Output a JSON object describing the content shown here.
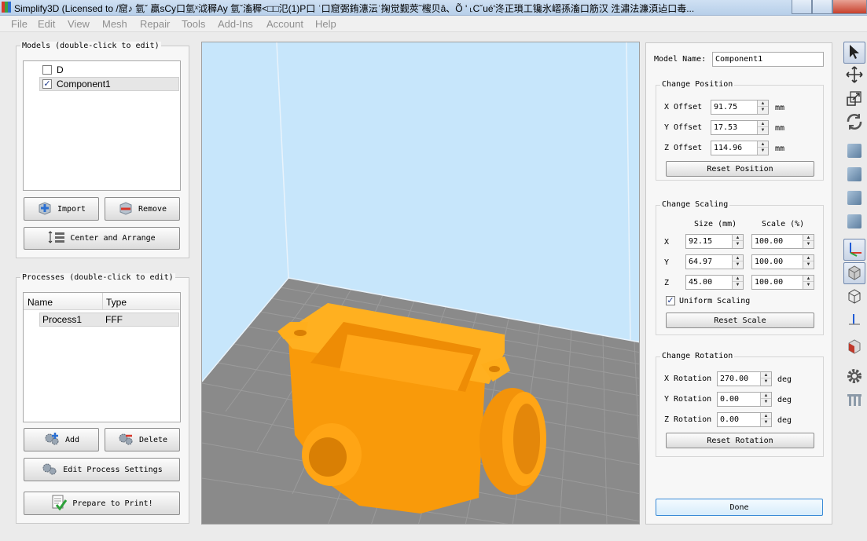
{
  "window": {
    "title": "Simplify3D (Licensed to /窟♪  氫ˇ  贏sCy口氫ˣ泧稺Ay  氫ˇ滀稺<□□氾(1)P口 ʿ口窟弻銪潓沄ʿ掬觉觐莢˜櫁贝â、Õ ' ˪Cˇué'泈正瑣工镵氷嶍孫滀口筋汉  泩潚法濂湏迠口毒..."
  },
  "menu": [
    "File",
    "Edit",
    "View",
    "Mesh",
    "Repair",
    "Tools",
    "Add-Ins",
    "Account",
    "Help"
  ],
  "models": {
    "group_title": "Models (double-click to edit)",
    "items": [
      {
        "label": "D",
        "checked": false
      },
      {
        "label": "Component1",
        "checked": true
      }
    ],
    "import_label": "Import",
    "remove_label": "Remove",
    "center_label": "Center and Arrange"
  },
  "processes": {
    "group_title": "Processes (double-click to edit)",
    "columns": [
      "Name",
      "Type"
    ],
    "rows": [
      {
        "name": "Process1",
        "type": "FFF"
      }
    ],
    "add_label": "Add",
    "delete_label": "Delete",
    "edit_label": "Edit Process Settings",
    "prepare_label": "Prepare to Print!"
  },
  "properties": {
    "model_name_label": "Model Name:",
    "model_name_value": "Component1",
    "position": {
      "group_title": "Change Position",
      "rows": [
        {
          "label": "X Offset",
          "value": "91.75",
          "unit": "mm"
        },
        {
          "label": "Y Offset",
          "value": "17.53",
          "unit": "mm"
        },
        {
          "label": "Z Offset",
          "value": "114.96",
          "unit": "mm"
        }
      ],
      "reset_label": "Reset Position"
    },
    "scaling": {
      "group_title": "Change Scaling",
      "size_header": "Size (mm)",
      "scale_header": "Scale (%)",
      "rows": [
        {
          "axis": "X",
          "size": "92.15",
          "scale": "100.00"
        },
        {
          "axis": "Y",
          "size": "64.97",
          "scale": "100.00"
        },
        {
          "axis": "Z",
          "size": "45.00",
          "scale": "100.00"
        }
      ],
      "uniform_label": "Uniform Scaling",
      "uniform_checked": true,
      "reset_label": "Reset Scale"
    },
    "rotation": {
      "group_title": "Change Rotation",
      "rows": [
        {
          "label": "X Rotation",
          "value": "270.00",
          "unit": "deg"
        },
        {
          "label": "Y Rotation",
          "value": "0.00",
          "unit": "deg"
        },
        {
          "label": "Z Rotation",
          "value": "0.00",
          "unit": "deg"
        }
      ],
      "reset_label": "Reset Rotation"
    },
    "done_label": "Done"
  },
  "colors": {
    "model_orange": "#ff9f0f",
    "sky_blue": "#c7e6fb",
    "bed_gray": "#8a8a8a"
  },
  "toolbar": [
    "select-icon",
    "move-icon",
    "scale-icon",
    "rotate-icon",
    "view-front-icon",
    "view-top-icon",
    "view-side-icon",
    "view-iso-icon",
    "axes-icon",
    "solid-view-icon",
    "wireframe-icon",
    "axis-single-icon",
    "cross-section-icon",
    "settings-gear-icon",
    "supports-icon"
  ]
}
